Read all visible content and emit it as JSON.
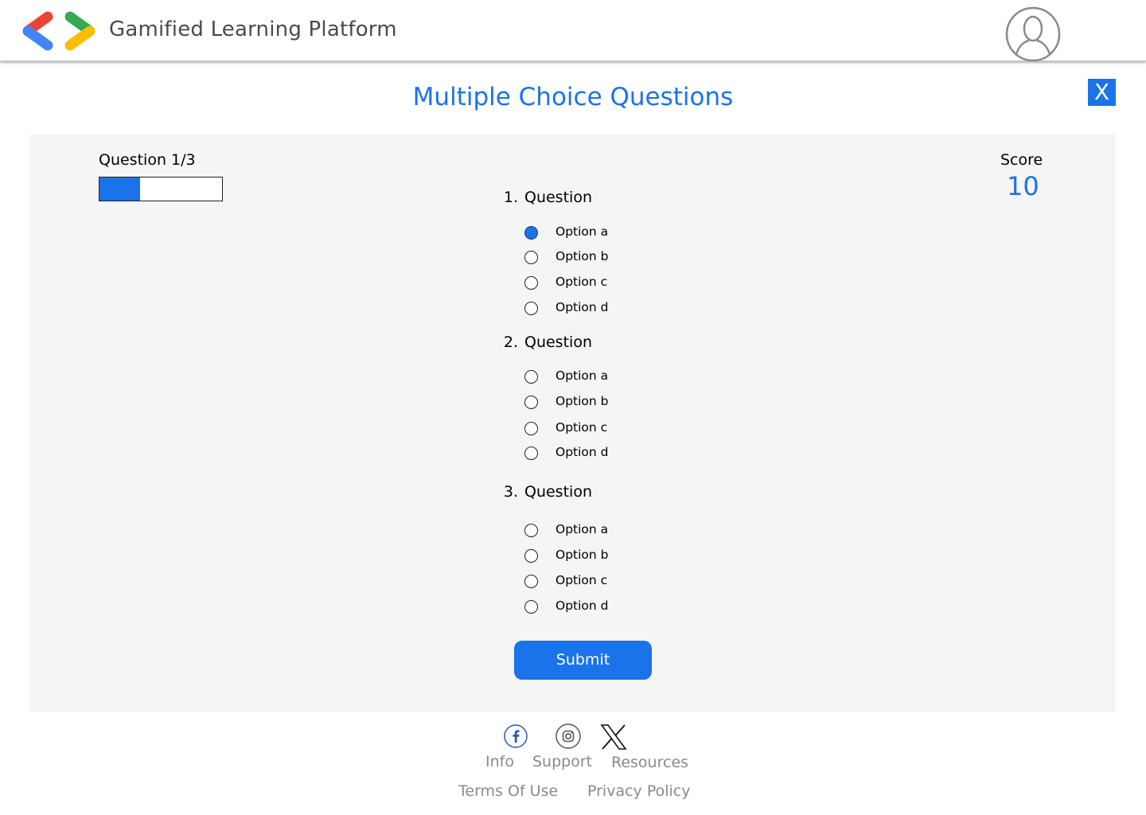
{
  "header": {
    "app_title": "Gamified Learning Platform",
    "logo_icon": "angle-brackets-logo",
    "avatar_icon": "user-avatar-icon"
  },
  "page_title": "Multiple Choice Questions",
  "close_label": "X",
  "progress": {
    "label": "Question 1/3",
    "fraction": 0.33
  },
  "score": {
    "label": "Score",
    "value": "10"
  },
  "questions": [
    {
      "number": "1.",
      "text": "Question",
      "options": [
        "Option a",
        "Option b",
        "Option c",
        "Option d"
      ],
      "selected": 0
    },
    {
      "number": "2.",
      "text": "Question",
      "options": [
        "Option a",
        "Option b",
        "Option c",
        "Option d"
      ],
      "selected": null
    },
    {
      "number": "3.",
      "text": "Question",
      "options": [
        "Option a",
        "Option b",
        "Option c",
        "Option d"
      ],
      "selected": null
    }
  ],
  "submit_label": "Submit",
  "footer": {
    "social_icons": [
      "facebook-icon",
      "instagram-icon",
      "x-icon"
    ],
    "links_row1": [
      "Info",
      "Support",
      "Resources"
    ],
    "links_row2": [
      "Terms Of Use",
      "Privacy Policy"
    ]
  },
  "colors": {
    "accent": "#1a73e8",
    "panel_bg": "#f5f5f5",
    "footer_text": "#8a8a8a"
  }
}
